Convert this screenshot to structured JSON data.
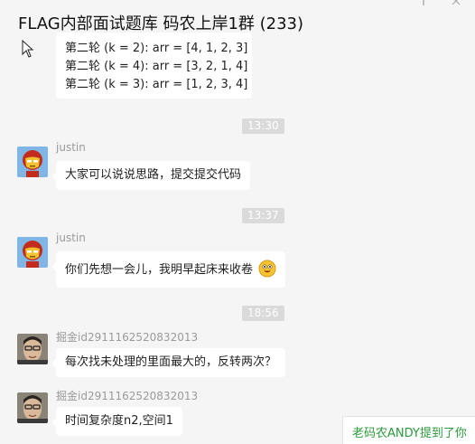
{
  "window": {
    "title": "FLAG内部面试题库 码农上岸1群 (233)"
  },
  "icons": {
    "pin": "pin-icon",
    "close": "close-icon",
    "cursor": "mouse-pointer-icon",
    "emoji": "grinning-face-emoji"
  },
  "messages": [
    {
      "type": "text-continued",
      "lines": [
        "第二轮 (k = 2): arr = [4, 1, 2, 3]",
        "第二轮 (k = 4): arr = [3, 2, 1, 4]",
        "第二轮 (k = 3): arr = [1, 2, 3, 4]"
      ]
    },
    {
      "type": "time",
      "text": "13:30"
    },
    {
      "type": "text",
      "sender": "justin",
      "avatar": "ironman-avatar",
      "text": "大家可以说说思路，提交提交代码"
    },
    {
      "type": "time",
      "text": "13:37"
    },
    {
      "type": "text",
      "sender": "justin",
      "avatar": "ironman-avatar",
      "text": "你们先想一会儿，我明早起床来收卷"
    },
    {
      "type": "time",
      "text": "18:56"
    },
    {
      "type": "text",
      "sender": "掘金id2911162520832013",
      "avatar": "photo-avatar",
      "text": "每次找未处理的里面最大的，反转两次？"
    },
    {
      "type": "text",
      "sender": "掘金id2911162520832013",
      "avatar": "photo-avatar",
      "text": "时间复杂度n2,空间1"
    }
  ],
  "mention_banner": {
    "text": "老码农ANDY提到了你"
  },
  "colors": {
    "background": "#f5f5f5",
    "bubble": "#ffffff",
    "time_badge": "#dadada",
    "sender_name": "#9a9a9a",
    "mention_text": "#2a9a3a"
  }
}
